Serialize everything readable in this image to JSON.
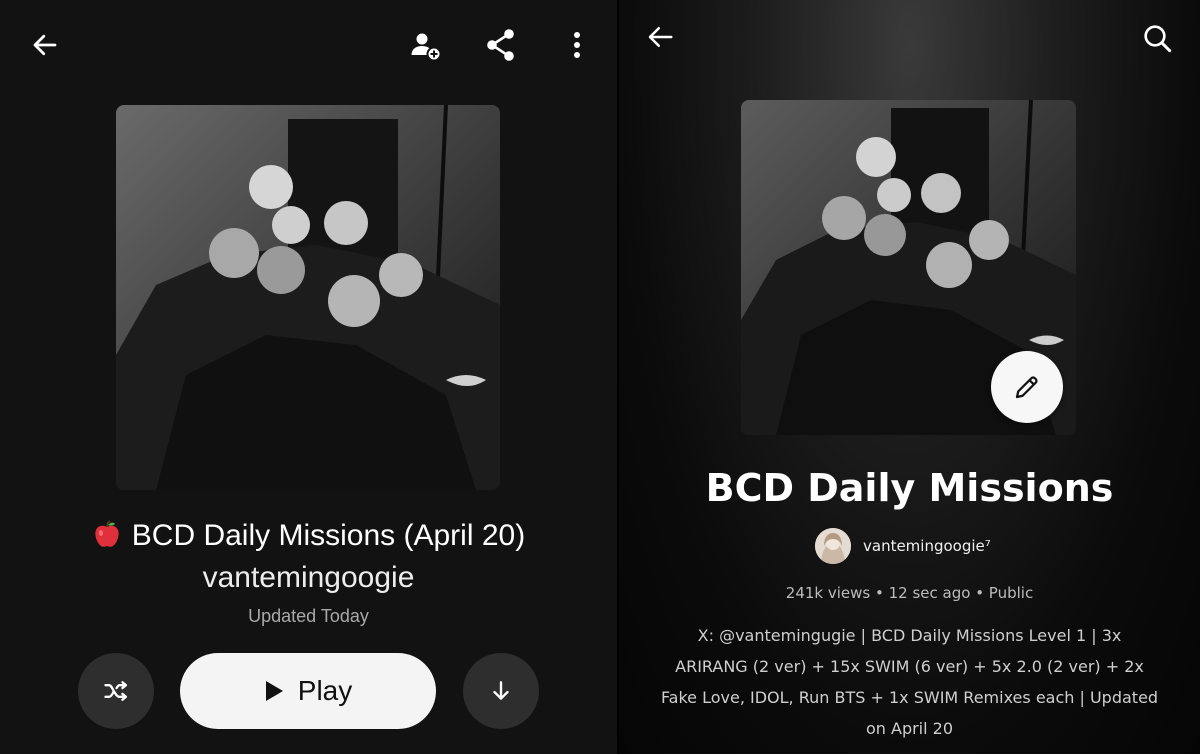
{
  "left_screen": {
    "header": {
      "back_icon": "arrow-left-icon",
      "actions": [
        "add-collaborator-icon",
        "share-icon",
        "more-vertical-icon"
      ]
    },
    "playlist": {
      "title": "BCD Daily Missions (April 20)",
      "title_emoji": "red-apple-icon",
      "author": "vantemingoogie",
      "updated": "Updated Today"
    },
    "controls": {
      "shuffle_icon": "shuffle-icon",
      "play_label": "Play",
      "download_icon": "download-arrow-icon"
    }
  },
  "right_screen": {
    "header": {
      "back_icon": "arrow-left-icon",
      "search_icon": "search-icon"
    },
    "playlist": {
      "title": "BCD Daily Missions",
      "username": "vantemingoogie⁷",
      "meta": "241k views • 12 sec ago • Public",
      "description": "X: @vantemingugie | BCD Daily Missions Level 1 | 3x ARIRANG (2 ver) + 15x SWIM (6 ver) + 5x 2.0 (2 ver) + 2x Fake Love, IDOL, Run BTS + 1x SWIM Remixes each | Updated on April 20",
      "edit_icon": "pencil-icon"
    }
  },
  "colors": {
    "left_background": "#121212",
    "button_dark": "#2e2e2e",
    "play_button": "#f4f4f4",
    "apple_red": "#e0303b"
  }
}
